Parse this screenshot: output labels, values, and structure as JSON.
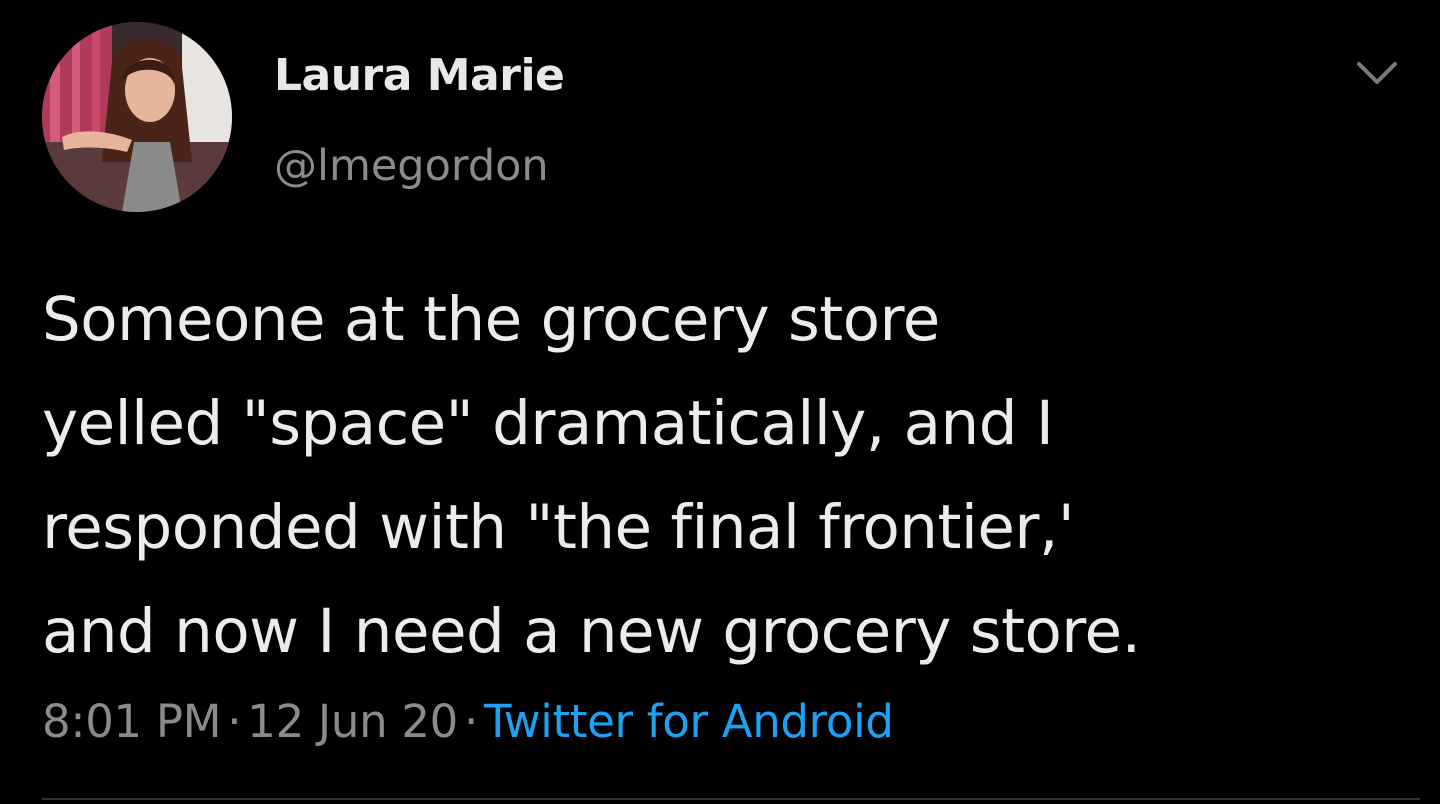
{
  "tweet": {
    "author": {
      "display_name": "Laura Marie",
      "handle": "@lmegordon",
      "avatar_icon": "avatar-photo"
    },
    "menu_icon": "chevron-down-icon",
    "text_lines": [
      "Someone at the grocery store",
      "yelled \"space\" dramatically, and I",
      "responded with \"the final frontier,'",
      "and now I need a new grocery store."
    ],
    "meta": {
      "time": "8:01 PM",
      "separator": "·",
      "date": "12 Jun 20",
      "source": "Twitter for Android"
    }
  },
  "colors": {
    "background": "#000000",
    "primary_text": "#e6e6e6",
    "secondary_text": "#8b8b8b",
    "link": "#1da1f2"
  }
}
